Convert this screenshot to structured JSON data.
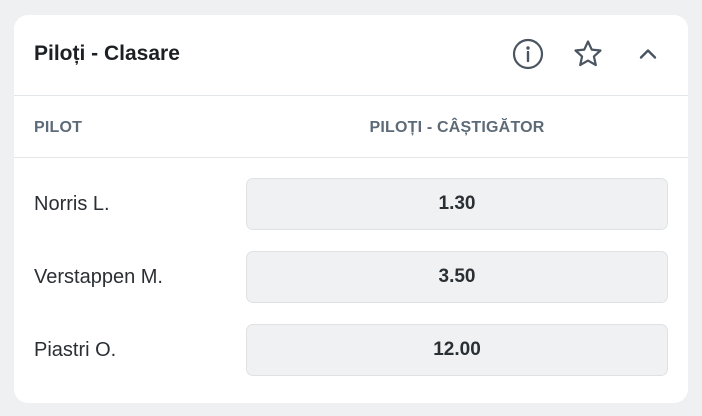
{
  "widget": {
    "title": "Piloți - Clasare",
    "icons": {
      "info": "info-circle-icon",
      "favorite": "star-outline-icon",
      "collapse": "chevron-up-icon"
    }
  },
  "table": {
    "columns": {
      "pilot": "PILOT",
      "market": "PILOȚI - CÂȘTIGĂTOR"
    },
    "rows": [
      {
        "pilot": "Norris L.",
        "odds": "1.30"
      },
      {
        "pilot": "Verstappen M.",
        "odds": "3.50"
      },
      {
        "pilot": "Piastri O.",
        "odds": "12.00"
      }
    ]
  },
  "colors": {
    "page_background": "#eef0f2",
    "card_background": "#ffffff",
    "title_text": "#1c2024",
    "column_header_text": "#5d6b78",
    "odds_button_background": "#f0f1f2",
    "divider": "#e4e7ea"
  }
}
